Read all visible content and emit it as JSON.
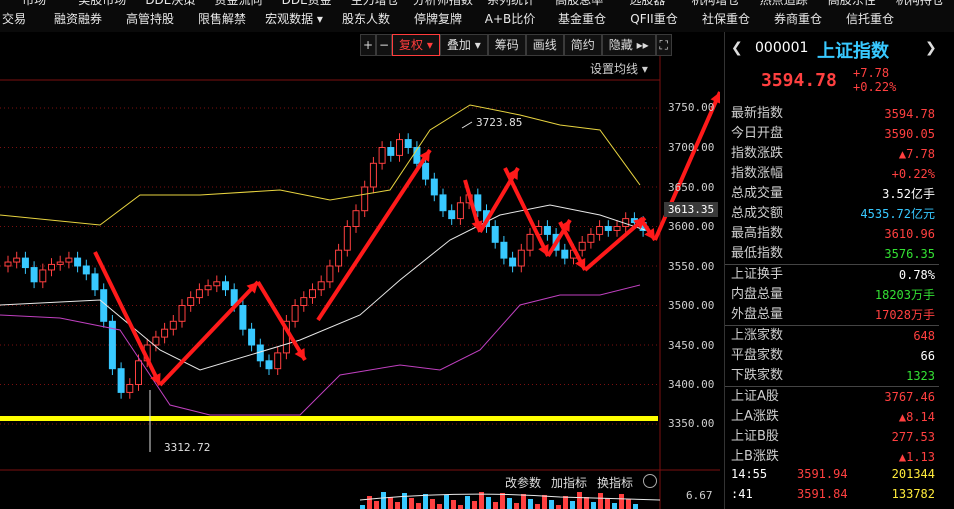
{
  "nav": {
    "row1": [
      "市场",
      "美股市场",
      "DDE决策",
      "资金流向",
      "DDE资金",
      "主力增仓",
      "分析师指数",
      "系列统计",
      "高股息率",
      "选股器",
      "机构增仓",
      "热点追踪",
      "高股东性",
      "机构持仓"
    ],
    "row2": [
      "交易",
      "融资融券",
      "高管持股",
      "限售解禁",
      "宏观数据 ▾",
      "股东人数",
      "停牌复牌",
      "A+B比价",
      "基金重仓",
      "QFII重仓",
      "社保重仓",
      "券商重仓",
      "信托重仓"
    ]
  },
  "toolbar": {
    "plus": "+",
    "minus": "−",
    "fuquan": "复权",
    "diejia": "叠加",
    "chouma": "筹码",
    "huaxian": "画线",
    "jianyue": "简约",
    "yincang": "隐藏",
    "expand": "⛶"
  },
  "chart": {
    "setting_label": "设置均线 ▾",
    "y_ticks": [
      "3750.00",
      "3700.00",
      "3650.00",
      "3600.00",
      "3550.00",
      "3500.00",
      "3450.00",
      "3400.00",
      "3350.00"
    ],
    "current_price": "3613.35",
    "high_annotation": "3723.85",
    "low_annotation": "3312.72",
    "bottom_buttons": [
      "改参数",
      "加指标",
      "换指标"
    ],
    "vol_value": "6.67"
  },
  "quote": {
    "code": "000001",
    "name": "上证指数",
    "price": "3594.78",
    "change": "+7.78",
    "change_pct": "+0.22%",
    "rows": [
      {
        "label": "最新指数",
        "value": "3594.78",
        "color": "red"
      },
      {
        "label": "今日开盘",
        "value": "3590.05",
        "color": "red"
      },
      {
        "label": "指数涨跌",
        "value": "▲7.78",
        "color": "red"
      },
      {
        "label": "指数涨幅",
        "value": "+0.22%",
        "color": "red"
      },
      {
        "label": "总成交量",
        "value": "3.52亿手",
        "color": "white"
      },
      {
        "label": "总成交额",
        "value": "4535.72亿元",
        "color": "cyan"
      },
      {
        "label": "最高指数",
        "value": "3610.96",
        "color": "red"
      },
      {
        "label": "最低指数",
        "value": "3576.35",
        "color": "green"
      },
      {
        "label": "上证换手",
        "value": "0.78%",
        "color": "white",
        "sep": true
      },
      {
        "label": "内盘总量",
        "value": "18203万手",
        "color": "green"
      },
      {
        "label": "外盘总量",
        "value": "17028万手",
        "color": "red"
      },
      {
        "label": "上涨家数",
        "value": "648",
        "color": "red",
        "sep": true
      },
      {
        "label": "平盘家数",
        "value": "66",
        "color": "white"
      },
      {
        "label": "下跌家数",
        "value": "1323",
        "color": "green"
      },
      {
        "label": "上证A股",
        "value": "3767.46",
        "color": "red",
        "sep": true
      },
      {
        "label": "上A涨跌",
        "value": "▲8.14",
        "color": "red"
      },
      {
        "label": "上证B股",
        "value": "277.53",
        "color": "red"
      },
      {
        "label": "上B涨跌",
        "value": "▲1.13",
        "color": "red"
      }
    ],
    "ticks": [
      {
        "time": "14:55",
        "price": "3591.94",
        "vol": "201344"
      },
      {
        "time": ":41",
        "price": "3591.84",
        "vol": "133782"
      }
    ]
  },
  "colors": {
    "up": "#ff4040",
    "down": "#38c9ff",
    "arrow": "#ff1a1a",
    "support": "#ffff00"
  }
}
